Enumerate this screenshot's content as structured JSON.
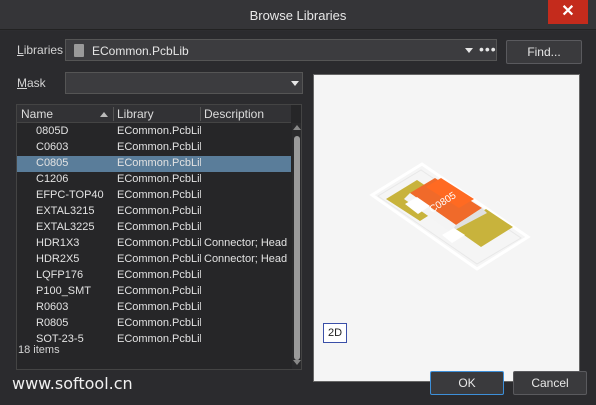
{
  "window": {
    "title": "Browse Libraries",
    "close_glyph": "✕"
  },
  "libraries": {
    "label_prefix": "",
    "label_accel": "L",
    "label_rest": "ibraries",
    "value": "ECommon.PcbLib",
    "more_glyph": "•••"
  },
  "find_button": "Find...",
  "mask": {
    "label_accel": "M",
    "label_rest": "ask",
    "value": ""
  },
  "table": {
    "headers": {
      "name": "Name",
      "library": "Library",
      "description": "Description"
    },
    "rows": [
      {
        "name": "0805D",
        "library": "ECommon.PcbLib",
        "description": ""
      },
      {
        "name": "C0603",
        "library": "ECommon.PcbLib",
        "description": ""
      },
      {
        "name": "C0805",
        "library": "ECommon.PcbLib",
        "description": ""
      },
      {
        "name": "C1206",
        "library": "ECommon.PcbLib",
        "description": ""
      },
      {
        "name": "EFPC-TOP40",
        "library": "ECommon.PcbLib",
        "description": ""
      },
      {
        "name": "EXTAL3215",
        "library": "ECommon.PcbLib",
        "description": ""
      },
      {
        "name": "EXTAL3225",
        "library": "ECommon.PcbLib",
        "description": ""
      },
      {
        "name": "HDR1X3",
        "library": "ECommon.PcbLib",
        "description": "Connector; Head"
      },
      {
        "name": "HDR2X5",
        "library": "ECommon.PcbLib",
        "description": "Connector; Head"
      },
      {
        "name": "LQFP176",
        "library": "ECommon.PcbLib",
        "description": ""
      },
      {
        "name": "P100_SMT",
        "library": "ECommon.PcbLib",
        "description": ""
      },
      {
        "name": "R0603",
        "library": "ECommon.PcbLib",
        "description": ""
      },
      {
        "name": "R0805",
        "library": "ECommon.PcbLib",
        "description": ""
      },
      {
        "name": "SOT-23-5",
        "library": "ECommon.PcbLib",
        "description": ""
      }
    ],
    "selected_index": 2
  },
  "items_count": "18 items",
  "preview": {
    "component_label": "C0805",
    "mode_button": "2D"
  },
  "footer": {
    "watermark": "www.softool.cn",
    "ok": "OK",
    "cancel": "Cancel"
  },
  "colors": {
    "selection": "#5a7d9a",
    "close": "#c42b1c",
    "orange": "#f06a2a",
    "pad": "#c8b33c"
  }
}
